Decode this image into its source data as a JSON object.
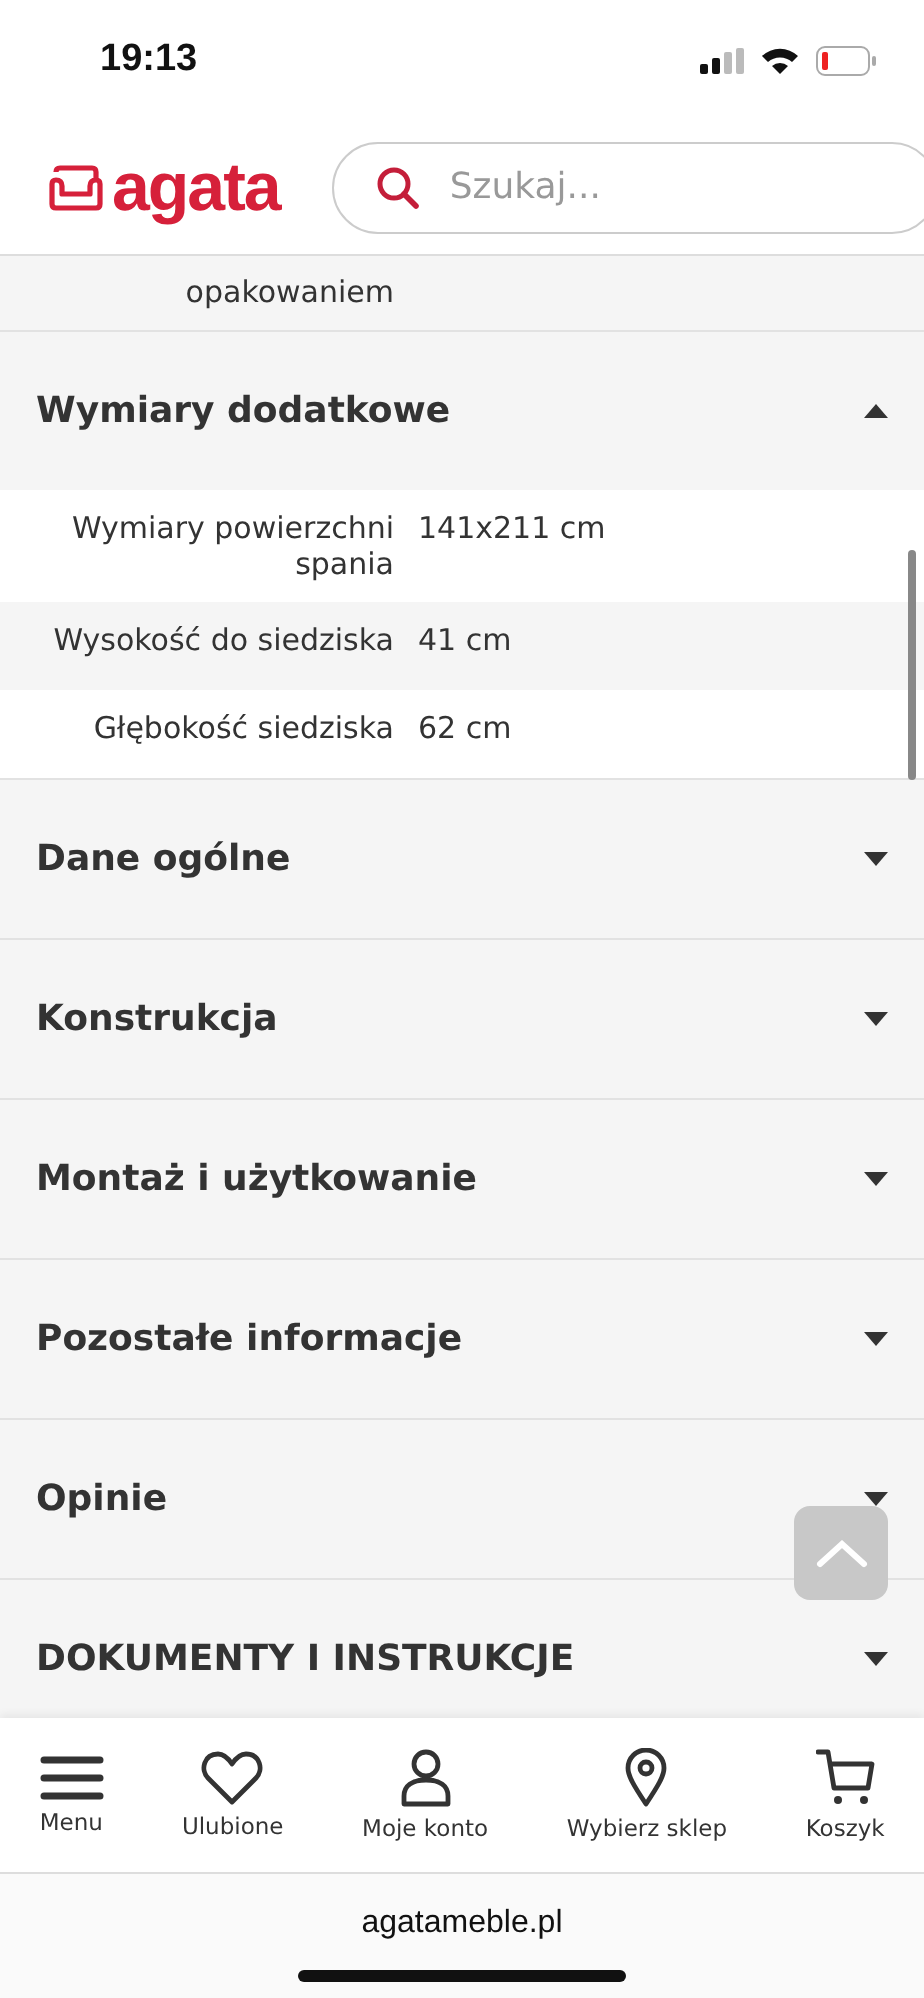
{
  "status_bar": {
    "time": "19:13"
  },
  "header": {
    "logo": "agata",
    "search": {
      "placeholder": "Szukaj..."
    }
  },
  "partial_row": {
    "label": "opakowaniem"
  },
  "sections": [
    {
      "title": "Wymiary dodatkowe",
      "expanded": true,
      "rows": [
        {
          "label": "Wymiary powierzchni spania",
          "value": "141x211 cm"
        },
        {
          "label": "Wysokość do siedziska",
          "value": "41 cm"
        },
        {
          "label": "Głębokość siedziska",
          "value": "62 cm"
        }
      ]
    },
    {
      "title": "Dane ogólne",
      "expanded": false
    },
    {
      "title": "Konstrukcja",
      "expanded": false
    },
    {
      "title": "Montaż i użytkowanie",
      "expanded": false
    },
    {
      "title": "Pozostałe informacje",
      "expanded": false
    },
    {
      "title": "Opinie",
      "expanded": false
    },
    {
      "title": "DOKUMENTY I INSTRUKCJE",
      "expanded": false
    }
  ],
  "bottom_nav": [
    {
      "kind": "menu",
      "label": "Menu"
    },
    {
      "kind": "heart",
      "label": "Ulubione"
    },
    {
      "kind": "user",
      "label": "Moje konto"
    },
    {
      "kind": "pin",
      "label": "Wybierz sklep"
    },
    {
      "kind": "cart",
      "label": "Koszyk"
    }
  ],
  "address_bar": {
    "url": "agatameble.pl"
  }
}
